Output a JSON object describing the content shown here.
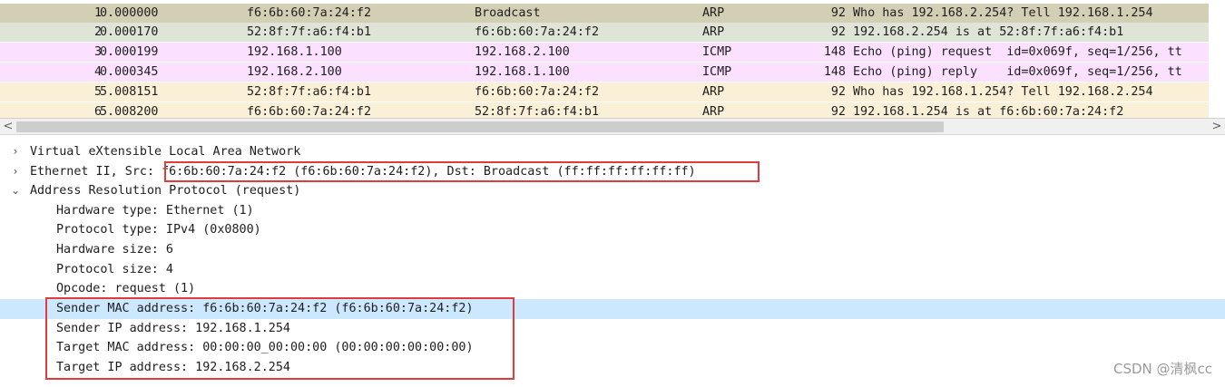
{
  "packets": [
    {
      "no": "1",
      "time": "0.000000",
      "src": "f6:6b:60:7a:24:f2",
      "dst": "Broadcast",
      "proto": "ARP",
      "len": "92",
      "info": "Who has 192.168.2.254? Tell 192.168.1.254",
      "bg": "#d3cfb4"
    },
    {
      "no": "2",
      "time": "0.000170",
      "src": "52:8f:7f:a6:f4:b1",
      "dst": "f6:6b:60:7a:24:f2",
      "proto": "ARP",
      "len": "92",
      "info": "192.168.2.254 is at 52:8f:7f:a6:f4:b1",
      "bg": "#dfe4d6"
    },
    {
      "no": "3",
      "time": "0.000199",
      "src": "192.168.1.100",
      "dst": "192.168.2.100",
      "proto": "ICMP",
      "len": "148",
      "info": "Echo (ping) request  id=0x069f, seq=1/256, tt",
      "bg": "#fce0ff"
    },
    {
      "no": "4",
      "time": "0.000345",
      "src": "192.168.2.100",
      "dst": "192.168.1.100",
      "proto": "ICMP",
      "len": "148",
      "info": "Echo (ping) reply    id=0x069f, seq=1/256, tt",
      "bg": "#fce0ff"
    },
    {
      "no": "5",
      "time": "5.008151",
      "src": "52:8f:7f:a6:f4:b1",
      "dst": "f6:6b:60:7a:24:f2",
      "proto": "ARP",
      "len": "92",
      "info": "Who has 192.168.1.254? Tell 192.168.2.254",
      "bg": "#faf0d7"
    },
    {
      "no": "6",
      "time": "5.008200",
      "src": "f6:6b:60:7a:24:f2",
      "dst": "52:8f:7f:a6:f4:b1",
      "proto": "ARP",
      "len": "92",
      "info": "192.168.1.254 is at f6:6b:60:7a:24:f2",
      "bg": "#faf0d7"
    }
  ],
  "scrollbar": {
    "left_arrow": "<",
    "right_arrow": ">"
  },
  "details": {
    "vxlan": "Virtual eXtensible Local Area Network",
    "eth_prefix": "Ethernet II, Src: ",
    "eth_highlight": "f6:6b:60:7a:24:f2 (f6:6b:60:7a:24:f2), Dst: Broadcast (ff:ff:ff:ff:ff:ff)",
    "arp": "Address Resolution Protocol (request)",
    "arp_fields": {
      "hw_type": "Hardware type: Ethernet (1)",
      "proto_type": "Protocol type: IPv4 (0x0800)",
      "hw_size": "Hardware size: 6",
      "proto_size": "Protocol size: 4",
      "opcode": "Opcode: request (1)",
      "sender_mac": "Sender MAC address: f6:6b:60:7a:24:f2 (f6:6b:60:7a:24:f2)",
      "sender_ip": "Sender IP address: 192.168.1.254",
      "target_mac": "Target MAC address: 00:00:00_00:00:00 (00:00:00:00:00:00)",
      "target_ip": "Target IP address: 192.168.2.254"
    },
    "collapsed_icon": "chevron-right-icon",
    "expanded_icon": "chevron-down-icon"
  },
  "colors": {
    "selected_row": "#cce8ff",
    "highlight_box": "#e23b3b"
  },
  "watermark": "CSDN @清枫cc"
}
